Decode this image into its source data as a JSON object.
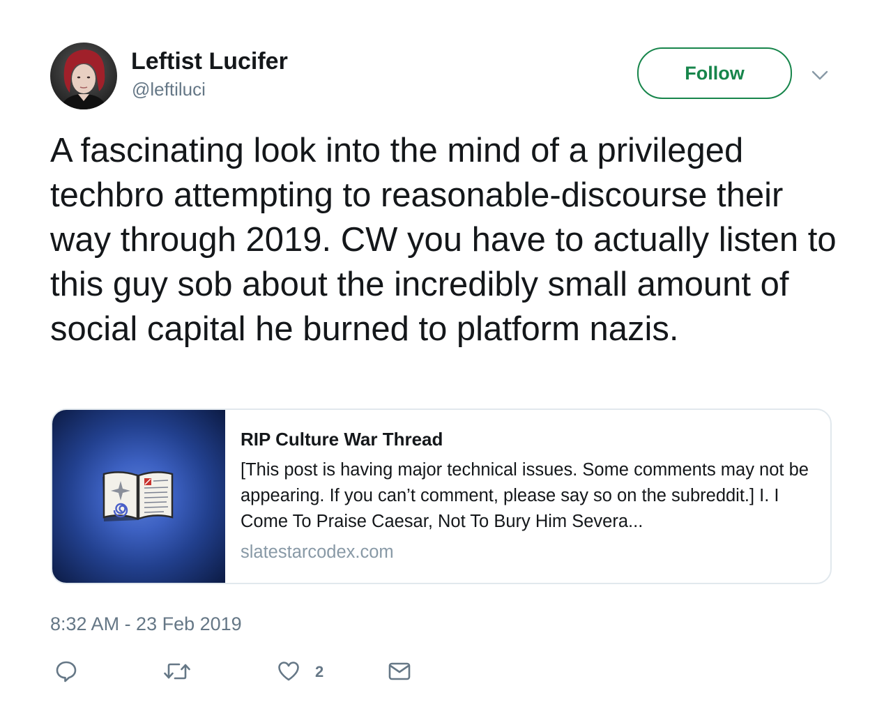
{
  "tweet": {
    "author": {
      "display_name": "Leftist Lucifer",
      "handle": "@leftiluci"
    },
    "follow_label": "Follow",
    "text": "A fascinating look into the mind of a privileged techbro attempting to reasonable-discourse their way through 2019. CW you have to actually listen to this guy sob about the incredibly small amount of social capital he burned to platform nazis.",
    "card": {
      "title": "RIP Culture War Thread",
      "description": "[This post is having major technical issues. Some comments may not be appearing. If you can’t comment, please say so on the subreddit.] I. I Come To Praise Caesar, Not To Bury Him Severa...",
      "domain": "slatestarcodex.com",
      "image_icon": "open-book-icon"
    },
    "timestamp": "8:32 AM - 23 Feb 2019",
    "actions": {
      "reply_icon": "reply-icon",
      "retweet_icon": "retweet-icon",
      "like_icon": "heart-icon",
      "like_count": "2",
      "dm_icon": "envelope-icon"
    }
  },
  "colors": {
    "follow_accent": "#17854b",
    "text_primary": "#14171a",
    "text_secondary": "#657786",
    "card_border": "#e1e8ed"
  }
}
